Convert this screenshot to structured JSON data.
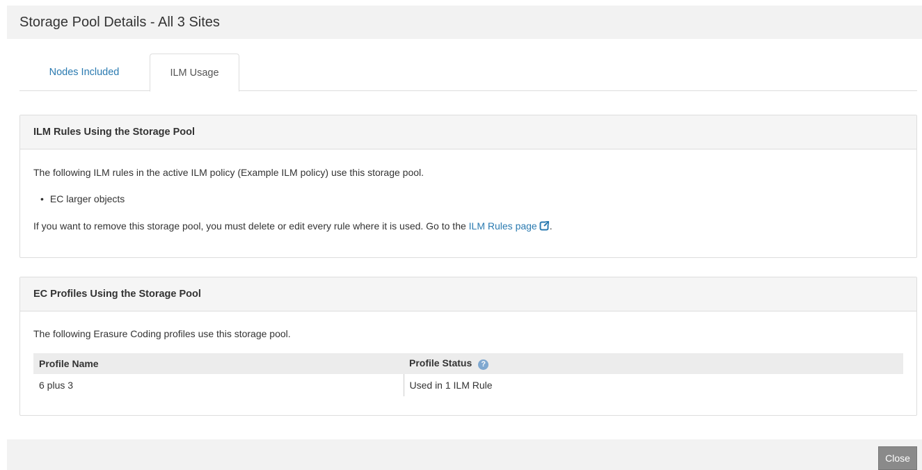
{
  "modal": {
    "title": "Storage Pool Details - All 3 Sites"
  },
  "tabs": [
    {
      "label": "Nodes Included",
      "active": false
    },
    {
      "label": "ILM Usage",
      "active": true
    }
  ],
  "ilm_rules_panel": {
    "heading": "ILM Rules Using the Storage Pool",
    "intro": "The following ILM rules in the active ILM policy (Example ILM policy) use this storage pool.",
    "rules": [
      "EC larger objects"
    ],
    "remove_note": "If you want to remove this storage pool, you must delete or edit every rule where it is used. Go to the ",
    "link_label": "ILM Rules page",
    "trailing": ".",
    "link_icon": "external-link-icon"
  },
  "ec_panel": {
    "heading": "EC Profiles Using the Storage Pool",
    "intro": "The following Erasure Coding profiles use this storage pool.",
    "columns": [
      "Profile Name",
      "Profile Status"
    ],
    "help_icon": "question-circle-icon",
    "rows": [
      {
        "name": "6 plus 3",
        "status": "Used in 1 ILM Rule"
      }
    ]
  },
  "footer": {
    "close_label": "Close"
  },
  "colors": {
    "link": "#2a7ab0",
    "close_button": "#8a8a8a",
    "help_icon": "#7fa8d0"
  }
}
